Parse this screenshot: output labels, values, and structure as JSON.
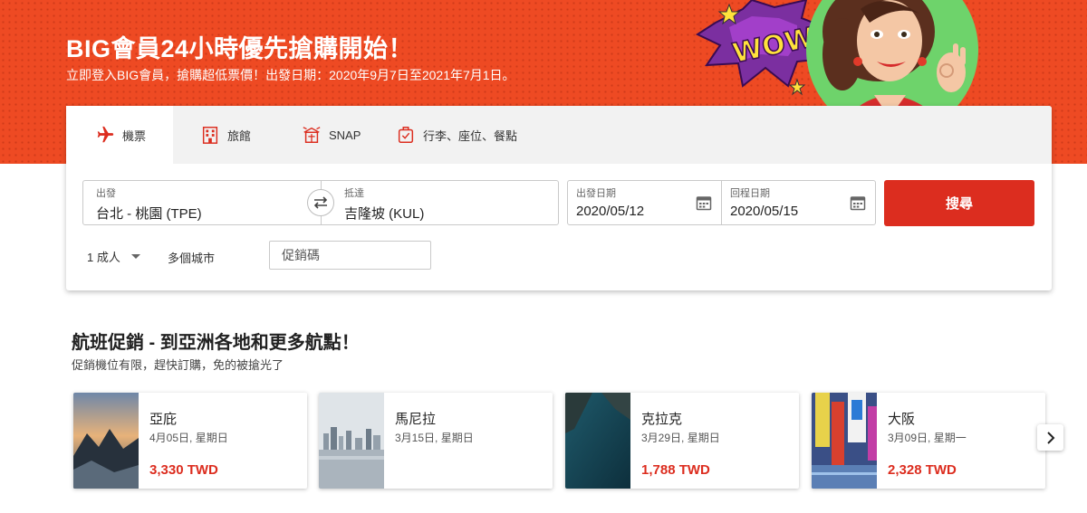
{
  "banner": {
    "title": "BIG會員24小時優先搶購開始！",
    "subtitle": "立即登入BIG會員，搶購超低票價！出發日期：2020年9月7日至2021年7月1日。",
    "art_text": "WOW!"
  },
  "tabs": [
    {
      "label": "機票",
      "icon": "airplane-icon",
      "active": true
    },
    {
      "label": "旅館",
      "icon": "hotel-icon",
      "active": false
    },
    {
      "label": "SNAP",
      "icon": "snap-icon",
      "active": false
    },
    {
      "label": "行李、座位、餐點",
      "icon": "luggage-icon",
      "active": false
    }
  ],
  "search": {
    "from_label": "出發",
    "from_value": "台北 - 桃園 (TPE)",
    "to_label": "抵達",
    "to_value": "吉隆坡 (KUL)",
    "depart_label": "出發日期",
    "depart_value": "2020/05/12",
    "return_label": "回程日期",
    "return_value": "2020/05/15",
    "search_button": "搜尋",
    "passengers": "1 成人",
    "multi_city": "多個城市",
    "promo_placeholder": "促銷碼"
  },
  "deals_section": {
    "title": "航班促銷 - 到亞洲各地和更多航點！",
    "subtitle": "促銷機位有限，趕快訂購，免的被搶光了"
  },
  "deals": [
    {
      "city": "亞庇",
      "date": "4月05日, 星期日",
      "price": "3,330 TWD"
    },
    {
      "city": "馬尼拉",
      "date": "3月15日, 星期日",
      "price": ""
    },
    {
      "city": "克拉克",
      "date": "3月29日, 星期日",
      "price": "1,788 TWD"
    },
    {
      "city": "大阪",
      "date": "3月09日, 星期一",
      "price": "2,328 TWD"
    }
  ],
  "colors": {
    "brand_red": "#dc2d1f",
    "banner_orange": "#ee4a23",
    "tab_bar": "#f2f2f2"
  }
}
